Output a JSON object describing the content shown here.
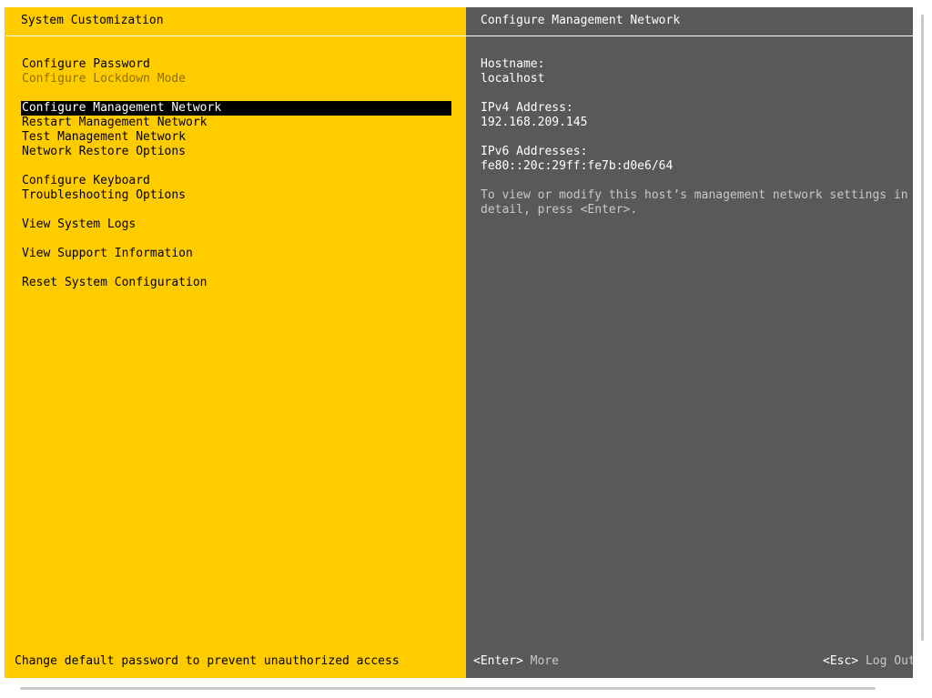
{
  "left": {
    "title": "System Customization",
    "menu": [
      {
        "label": "Configure Password",
        "state": "normal",
        "gap": false
      },
      {
        "label": "Configure Lockdown Mode",
        "state": "disabled",
        "gap": false
      },
      {
        "label": "Configure Management Network",
        "state": "selected",
        "gap": true
      },
      {
        "label": "Restart Management Network",
        "state": "normal",
        "gap": false
      },
      {
        "label": "Test Management Network",
        "state": "normal",
        "gap": false
      },
      {
        "label": "Network Restore Options",
        "state": "normal",
        "gap": false
      },
      {
        "label": "Configure Keyboard",
        "state": "normal",
        "gap": true
      },
      {
        "label": "Troubleshooting Options",
        "state": "normal",
        "gap": false
      },
      {
        "label": "View System Logs",
        "state": "normal",
        "gap": true
      },
      {
        "label": "View Support Information",
        "state": "normal",
        "gap": true
      },
      {
        "label": "Reset System Configuration",
        "state": "normal",
        "gap": true
      }
    ],
    "status": "Change default password to prevent unauthorized access"
  },
  "right": {
    "title": "Configure Management Network",
    "hostname_label": "Hostname:",
    "hostname_value": "localhost",
    "ipv4_label": "IPv4 Address:",
    "ipv4_value": "192.168.209.145",
    "ipv6_label": "IPv6 Addresses:",
    "ipv6_value": "fe80::20c:29ff:fe7b:d0e6/64",
    "hint_line1": "To view or modify this host’s management network settings in",
    "hint_line2": "detail, press <Enter>.",
    "footer_enter_key": "<Enter>",
    "footer_enter_desc": "More",
    "footer_esc_key": "<Esc>",
    "footer_esc_desc": "Log Out"
  },
  "colors": {
    "left_bg": "#ffcc00",
    "right_bg": "#595959",
    "selected_bg": "#000000",
    "disabled_text": "#8a7000"
  }
}
